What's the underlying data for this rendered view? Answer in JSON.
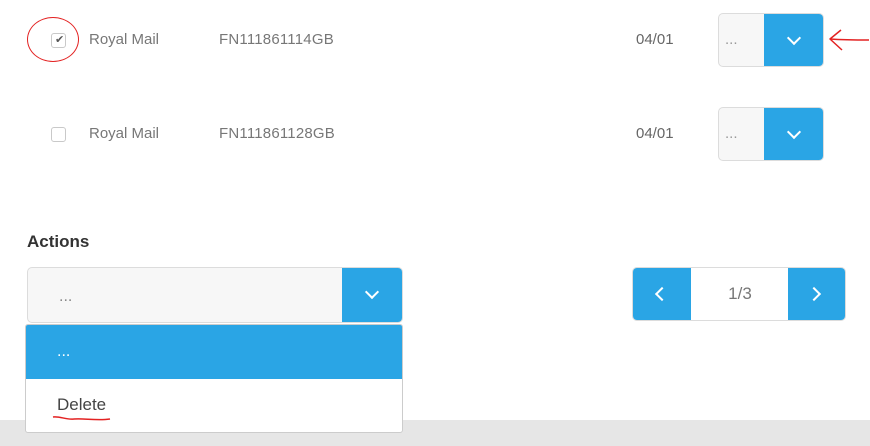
{
  "shipments": [
    {
      "carrier": "Royal Mail",
      "tracking": "FN111861114GB",
      "date": "04/01",
      "checked": true,
      "select_value": "..."
    },
    {
      "carrier": "Royal Mail",
      "tracking": "FN111861128GB",
      "date": "04/01",
      "checked": false,
      "select_value": "..."
    }
  ],
  "actions": {
    "label": "Actions",
    "selected": "...",
    "options": [
      "...",
      "Delete"
    ]
  },
  "pagination": {
    "page_text": "1/3"
  },
  "icons": {
    "checkmark": "checkmark-icon",
    "dropdown": "chevron-down-icon",
    "prev": "chevron-left-icon",
    "next": "chevron-right-icon"
  },
  "colors": {
    "accent": "#2aa5e5",
    "annotation": "#e32222",
    "footer": "#e6e6e6"
  }
}
